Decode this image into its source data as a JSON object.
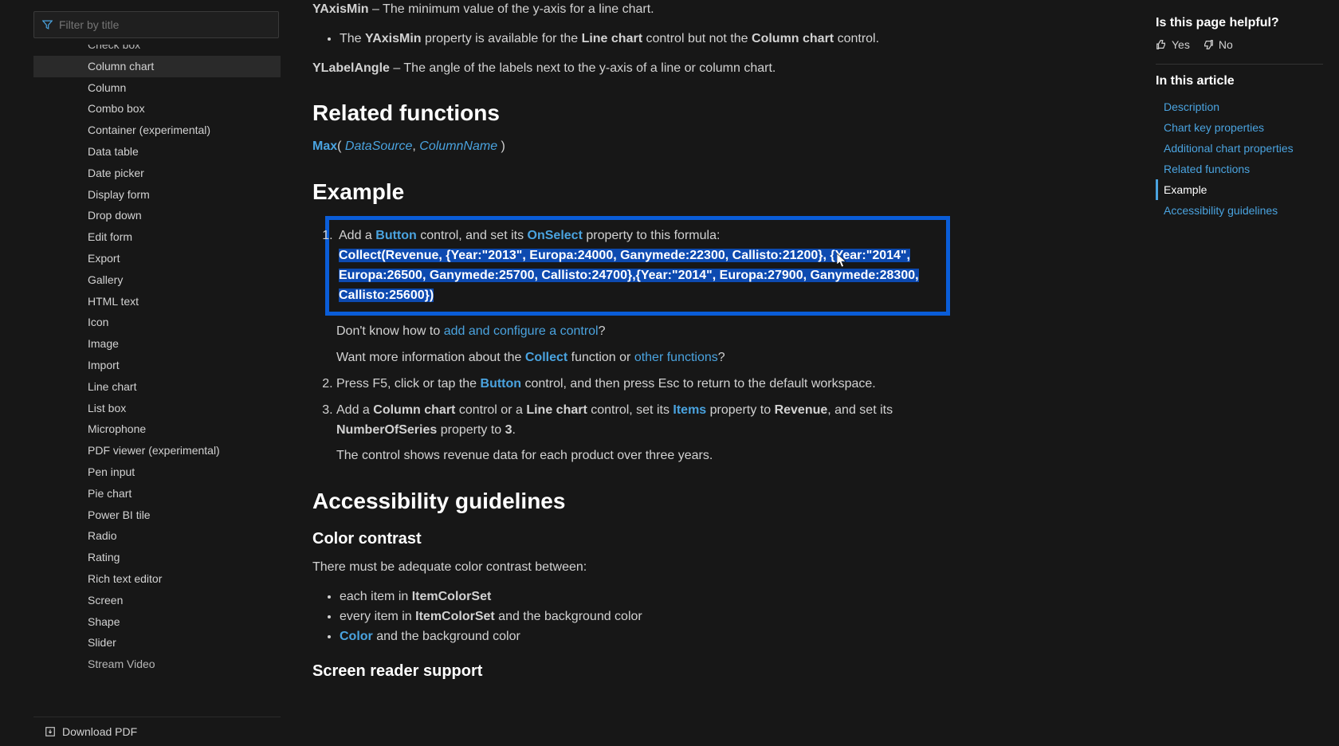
{
  "sidebar": {
    "filter_placeholder": "Filter by title",
    "items": [
      {
        "label": "Check box"
      },
      {
        "label": "Column chart",
        "active": true
      },
      {
        "label": "Column"
      },
      {
        "label": "Combo box"
      },
      {
        "label": "Container (experimental)"
      },
      {
        "label": "Data table"
      },
      {
        "label": "Date picker"
      },
      {
        "label": "Display form"
      },
      {
        "label": "Drop down"
      },
      {
        "label": "Edit form"
      },
      {
        "label": "Export"
      },
      {
        "label": "Gallery"
      },
      {
        "label": "HTML text"
      },
      {
        "label": "Icon"
      },
      {
        "label": "Image"
      },
      {
        "label": "Import"
      },
      {
        "label": "Line chart"
      },
      {
        "label": "List box"
      },
      {
        "label": "Microphone"
      },
      {
        "label": "PDF viewer (experimental)"
      },
      {
        "label": "Pen input"
      },
      {
        "label": "Pie chart"
      },
      {
        "label": "Power BI tile"
      },
      {
        "label": "Radio"
      },
      {
        "label": "Rating"
      },
      {
        "label": "Rich text editor"
      },
      {
        "label": "Screen"
      },
      {
        "label": "Shape"
      },
      {
        "label": "Slider"
      },
      {
        "label": "Stream Video"
      }
    ],
    "download_label": "Download PDF"
  },
  "content": {
    "yaxismin_label": "YAxisMin",
    "yaxismin_desc": " – The minimum value of the y-axis for a line chart.",
    "yaxismin_bullet_pre": "The ",
    "yaxismin_bullet_prop": "YAxisMin",
    "yaxismin_bullet_mid": " property is available for the ",
    "yaxismin_bullet_lc": "Line chart",
    "yaxismin_bullet_mid2": " control but not the ",
    "yaxismin_bullet_cc": "Column chart",
    "yaxismin_bullet_end": " control.",
    "ylabel_label": "YLabelAngle",
    "ylabel_desc": " – The angle of the labels next to the y-axis of a line or column chart.",
    "related_heading": "Related functions",
    "max_fn": "Max",
    "max_args_open": "( ",
    "max_arg1": "DataSource",
    "max_args_sep": ", ",
    "max_arg2": "ColumnName",
    "max_args_close": " )",
    "example_heading": "Example",
    "step1_pre": "Add a ",
    "step1_button": "Button",
    "step1_mid": " control, and set its ",
    "step1_onselect": "OnSelect",
    "step1_post": " property to this formula:",
    "step1_formula": "Collect(Revenue, {Year:\"2013\", Europa:24000, Ganymede:22300, Callisto:21200}, {Year:\"2014\", Europa:26500, Ganymede:25700, Callisto:24700},{Year:\"2014\", Europa:27900, Ganymede:28300, Callisto:25600})",
    "step1_dont_know_pre": "Don't know how to ",
    "step1_dont_know_link": "add and configure a control",
    "step1_dont_know_post": "?",
    "step1_want_pre": "Want more information about the ",
    "step1_want_collect": "Collect",
    "step1_want_mid": " function or ",
    "step1_want_other": "other functions",
    "step1_want_post": "?",
    "step2_pre": "Press F5, click or tap the ",
    "step2_button": "Button",
    "step2_post": " control, and then press Esc to return to the default workspace.",
    "step3_pre": "Add a ",
    "step3_cc": "Column chart",
    "step3_mid1": " control or a ",
    "step3_lc": "Line chart",
    "step3_mid2": " control, set its ",
    "step3_items": "Items",
    "step3_mid3": " property to ",
    "step3_rev": "Revenue",
    "step3_mid4": ", and set its ",
    "step3_nos": "NumberOfSeries",
    "step3_mid5": " property to ",
    "step3_three": "3",
    "step3_dot": ".",
    "step3_result": "The control shows revenue data for each product over three years.",
    "accessibility_heading": "Accessibility guidelines",
    "color_contrast_heading": "Color contrast",
    "color_contrast_intro": "There must be adequate color contrast between:",
    "cc_b1_pre": "each item in ",
    "cc_b1_bold": "ItemColorSet",
    "cc_b2_pre": "every item in ",
    "cc_b2_bold": "ItemColorSet",
    "cc_b2_post": " and the background color",
    "cc_b3_link": "Color",
    "cc_b3_post": " and the background color",
    "screen_reader_heading": "Screen reader support"
  },
  "rail": {
    "helpful_title": "Is this page helpful?",
    "yes": "Yes",
    "no": "No",
    "toc_title": "In this article",
    "toc": [
      {
        "label": "Description"
      },
      {
        "label": "Chart key properties"
      },
      {
        "label": "Additional chart properties"
      },
      {
        "label": "Related functions"
      },
      {
        "label": "Example",
        "active": true
      },
      {
        "label": "Accessibility guidelines"
      }
    ]
  }
}
